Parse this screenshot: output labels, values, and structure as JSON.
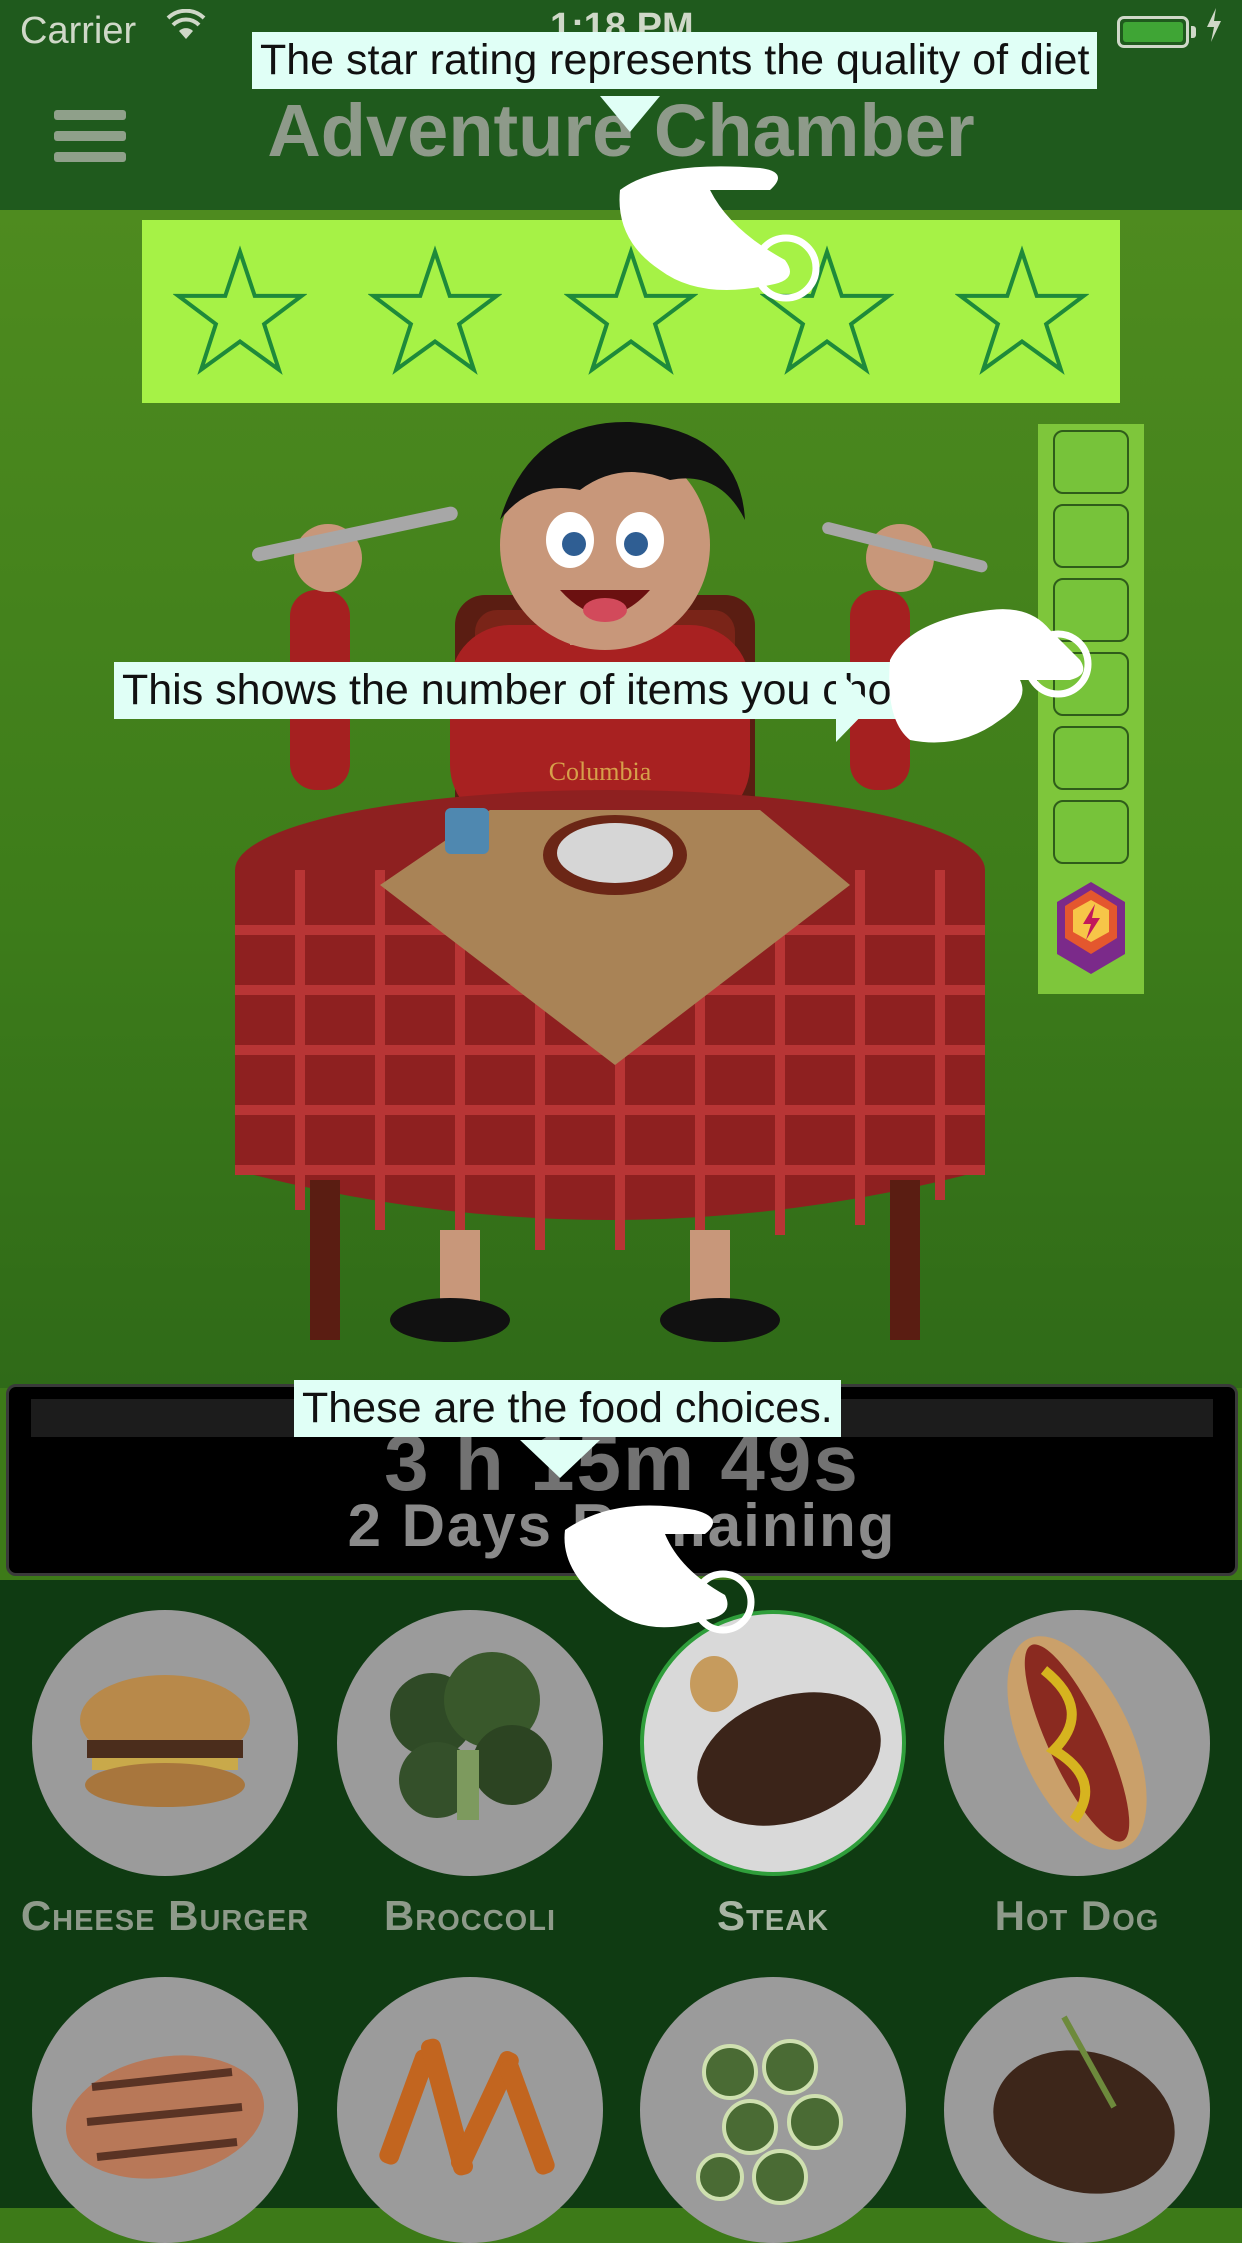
{
  "status": {
    "carrier": "Carrier",
    "time": "1:18 PM"
  },
  "header": {
    "title": "Adventure Chamber"
  },
  "stars": {
    "count": 5,
    "filled": 0
  },
  "counter": {
    "slots": 6,
    "filled": 0
  },
  "timer": {
    "countdown": "3 h 15m 49s",
    "remaining": "2 Days Remaining"
  },
  "foods": [
    {
      "label": "Cheese Burger",
      "selected": false
    },
    {
      "label": "Broccoli",
      "selected": false
    },
    {
      "label": "Steak",
      "selected": true
    },
    {
      "label": "Hot Dog",
      "selected": false
    },
    {
      "label": "",
      "selected": false
    },
    {
      "label": "",
      "selected": false
    },
    {
      "label": "",
      "selected": false
    },
    {
      "label": "",
      "selected": false
    }
  ],
  "tooltips": {
    "stars": "The star rating represents the quality of diet",
    "counter": "This shows the number of items you chose.",
    "foods": "These are the food choices."
  },
  "colors": {
    "header": "#1f5a1d",
    "stars_bar": "#a6f246",
    "counter": "#7ec63b",
    "food_bg": "#0f3b12",
    "tooltip_bg": "#e0fff6"
  }
}
